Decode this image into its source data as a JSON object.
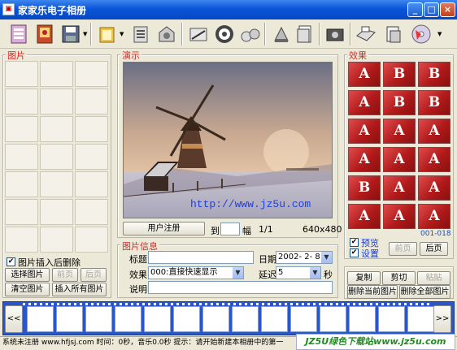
{
  "window": {
    "title": "家家乐电子相册",
    "icon": "app-photo-icon",
    "minimize": "_",
    "maximize": "□",
    "close": "×"
  },
  "toolbar": {
    "icons": [
      "album-icon",
      "photo-album-icon",
      "save-icon",
      "open-folder-icon",
      "notes-icon",
      "settings-box-icon",
      "edit-image-icon",
      "film-reel-icon",
      "music-icon",
      "stamp-icon",
      "document-icon",
      "camera-icon",
      "print-icon",
      "scanner-icon",
      "disc-icon"
    ]
  },
  "pictures": {
    "label": "图片",
    "delete_after_insert": "图片插入后删除",
    "buttons": {
      "select": "选择图片",
      "prev": "前页",
      "next": "后页",
      "clear": "清空图片",
      "insert_all": "插入所有图片"
    }
  },
  "preview": {
    "label": "演示",
    "watermark": "http://www.jz5u.com",
    "register_button": "用户注册",
    "goto_label": "到",
    "frame_unit": "幅",
    "page_index": "1/1",
    "resolution": "640x480"
  },
  "info": {
    "label": "图片信息",
    "title_label": "标题",
    "title_value": "",
    "date_label": "日期",
    "date_value": "2002- 2- 8",
    "effect_label": "效果",
    "effect_value": "000:直接快速显示",
    "delay_label": "延迟",
    "delay_value": "5",
    "delay_unit": "秒",
    "desc_label": "说明",
    "desc_value": ""
  },
  "effects": {
    "label": "效果",
    "tiles": [
      "A",
      "B",
      "B",
      "A",
      "B",
      "B",
      "A",
      "A",
      "A",
      "A",
      "A",
      "A",
      "B",
      "A",
      "A",
      "A",
      "A",
      "A"
    ],
    "range": "001-018",
    "preview_label": "预览",
    "settings_label": "设置",
    "prev": "前页",
    "next": "后页"
  },
  "edit": {
    "copy": "复制",
    "cut": "剪切",
    "paste": "粘贴",
    "delete_current": "删除当前图片",
    "delete_all": "删除全部图片"
  },
  "filmstrip": {
    "left": "<<",
    "right": ">>"
  },
  "statusbar": {
    "text": "系统未注册 www.hfjsj.com  时间：0秒，音乐0.0秒    提示：请开始新建本相册中的第一",
    "banner": "JZ5U绿色下载站www.jz5u.com"
  }
}
